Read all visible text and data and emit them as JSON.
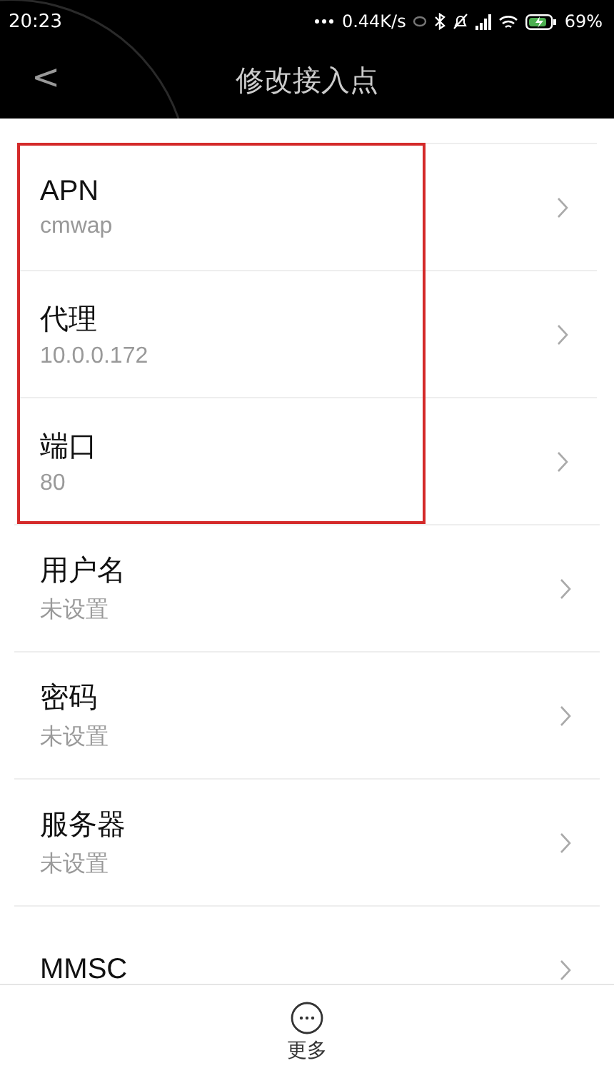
{
  "status_bar": {
    "time": "20:23",
    "speed": "0.44K/s",
    "battery": "69%"
  },
  "header": {
    "back": "<",
    "title": "修改接入点"
  },
  "items": [
    {
      "label": "APN",
      "value": "cmwap",
      "highlighted": true
    },
    {
      "label": "代理",
      "value": "10.0.0.172",
      "highlighted": true
    },
    {
      "label": "端口",
      "value": "80",
      "highlighted": true
    },
    {
      "label": "用户名",
      "value": "未设置",
      "highlighted": false
    },
    {
      "label": "密码",
      "value": "未设置",
      "highlighted": false
    },
    {
      "label": "服务器",
      "value": "未设置",
      "highlighted": false
    },
    {
      "label": "MMSC",
      "highlighted": false
    }
  ],
  "bottom_bar": {
    "more": "更多"
  }
}
